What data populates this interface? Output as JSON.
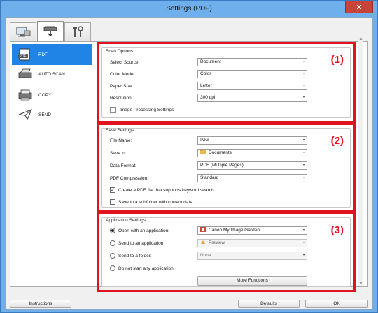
{
  "window": {
    "title": "Settings (PDF)",
    "close_glyph": "✕"
  },
  "tabs": [
    {
      "icon": "scan-from-computer-icon",
      "active": false
    },
    {
      "icon": "scan-from-operation-panel-icon",
      "active": true
    },
    {
      "icon": "general-settings-tools-icon",
      "active": false
    }
  ],
  "sidebar": {
    "items": [
      {
        "label": "PDF",
        "icon": "pdf-document-icon",
        "active": true
      },
      {
        "label": "AUTO SCAN",
        "icon": "auto-scan-icon",
        "active": false
      },
      {
        "label": "COPY",
        "icon": "copy-icon",
        "active": false
      },
      {
        "label": "SEND",
        "icon": "send-icon",
        "active": false
      }
    ]
  },
  "scan_options": {
    "title": "Scan Options",
    "number": "(1)",
    "select_source": {
      "label": "Select Source:",
      "value": "Document"
    },
    "color_mode": {
      "label": "Color Mode:",
      "value": "Color"
    },
    "paper_size": {
      "label": "Paper Size:",
      "value": "Letter"
    },
    "resolution": {
      "label": "Resolution:",
      "value": "300 dpi"
    },
    "image_processing": {
      "expander": "+",
      "label": "Image Processing Settings"
    }
  },
  "save_settings": {
    "title": "Save Settings",
    "number": "(2)",
    "file_name": {
      "label": "File Name:",
      "value": "IMG"
    },
    "save_in": {
      "label": "Save in:",
      "value": "Documents"
    },
    "data_format": {
      "label": "Data Format:",
      "value": "PDF (Multiple Pages)"
    },
    "pdf_compression": {
      "label": "PDF Compression:",
      "value": "Standard"
    },
    "keyword_search": {
      "label": "Create a PDF file that supports keyword search",
      "checked": true,
      "mark": "✓"
    },
    "subfolder": {
      "label": "Save to a subfolder with current date",
      "checked": false
    }
  },
  "application_settings": {
    "title": "Application Settings",
    "number": "(3)",
    "open_with_app": {
      "label": "Open with an application:",
      "value": "Canon My Image Garden",
      "selected": true
    },
    "send_to_app": {
      "label": "Send to an application:",
      "value": "Preview",
      "selected": false
    },
    "send_to_folder": {
      "label": "Send to a folder:",
      "value": "None",
      "selected": false
    },
    "do_not_start": {
      "label": "Do not start any application",
      "selected": false
    },
    "more_functions": "More Functions"
  },
  "footer": {
    "instructions": "Instructions",
    "defaults": "Defaults",
    "ok": "OK"
  },
  "colors": {
    "highlight_border": "#e0141f",
    "sidebar_active": "#1f84e6",
    "window_frame": "#6fb0ec"
  }
}
